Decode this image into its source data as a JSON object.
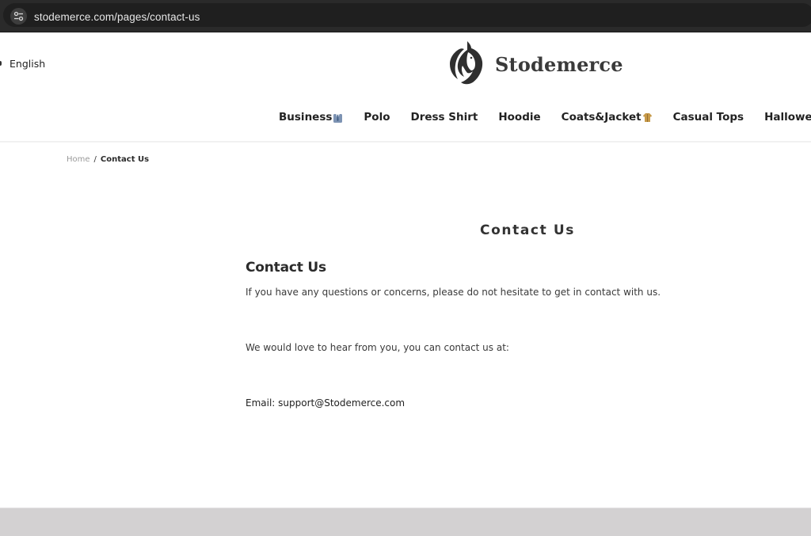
{
  "browser": {
    "url": "stodemerce.com/pages/contact-us",
    "site_settings_icon": "tune-icon"
  },
  "header": {
    "language": "English",
    "logo": {
      "icon": "horse-head-icon",
      "text": "Stodemerce"
    },
    "nav": [
      {
        "label": "Business",
        "emoji": "suit-icon"
      },
      {
        "label": "Polo"
      },
      {
        "label": "Dress Shirt"
      },
      {
        "label": "Hoodie"
      },
      {
        "label": "Coats&Jacket",
        "emoji": "coat-icon"
      },
      {
        "label": "Casual Tops"
      },
      {
        "label": "Halloween",
        "emoji": "pumpkin-icon"
      }
    ]
  },
  "breadcrumb": {
    "home": "Home",
    "separator": "/",
    "current": "Contact Us"
  },
  "main": {
    "page_title": "Contact Us",
    "heading": "Contact Us",
    "paragraphs": [
      "If you have any questions or concerns, please do not hesitate to get in contact with us.",
      "We would love to hear from you, you can contact us at:",
      "Email: support@Stodemerce.com"
    ]
  },
  "colors": {
    "browser_bar": "#2a2a2a",
    "text": "#2b2b2b",
    "muted": "#9a9a9a",
    "footer": "#d3d1d2"
  }
}
